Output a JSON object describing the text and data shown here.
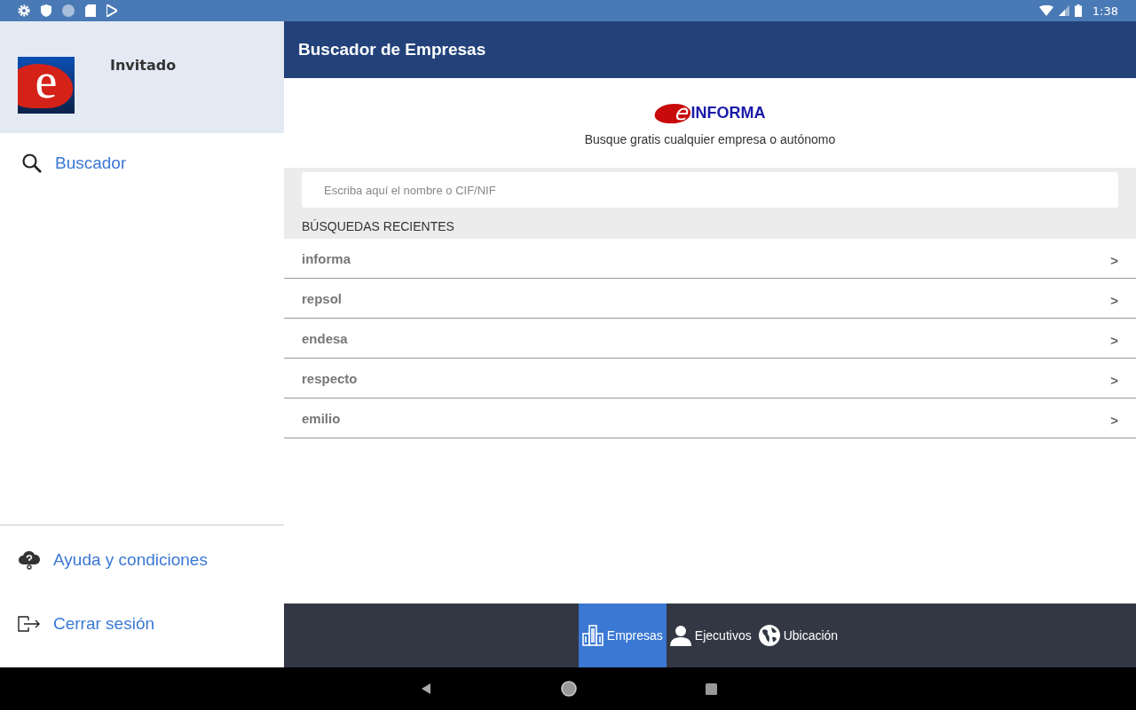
{
  "status_bar": {
    "time": "1:38"
  },
  "drawer": {
    "logo_letter": "e",
    "user": "Invitado",
    "items": [
      {
        "label": "Buscador",
        "kind": "search"
      }
    ],
    "footer_items": [
      {
        "label": "Ayuda y condiciones",
        "kind": "help"
      },
      {
        "label": "Cerrar sesión",
        "kind": "logout"
      }
    ]
  },
  "header": {
    "title": "Buscador de Empresas"
  },
  "brand": {
    "letter": "e",
    "name": "INFORMA",
    "tagline": "Busque gratis cualquier empresa o autónomo"
  },
  "search": {
    "placeholder": "Escriba aquí el nombre o CIF/NIF"
  },
  "recent": {
    "heading": "BÚSQUEDAS RECIENTES",
    "items": [
      {
        "label": "informa",
        "chevron": ">"
      },
      {
        "label": "repsol",
        "chevron": ">"
      },
      {
        "label": "endesa",
        "chevron": ">"
      },
      {
        "label": "respecto",
        "chevron": ">"
      },
      {
        "label": "emilio",
        "chevron": ">"
      }
    ]
  },
  "bottom_tabs": [
    {
      "label": "Empresas",
      "kind": "building",
      "selected": true
    },
    {
      "label": "Ejecutivos",
      "kind": "person",
      "selected": false
    },
    {
      "label": "Ubicación",
      "kind": "globe",
      "selected": false
    }
  ]
}
